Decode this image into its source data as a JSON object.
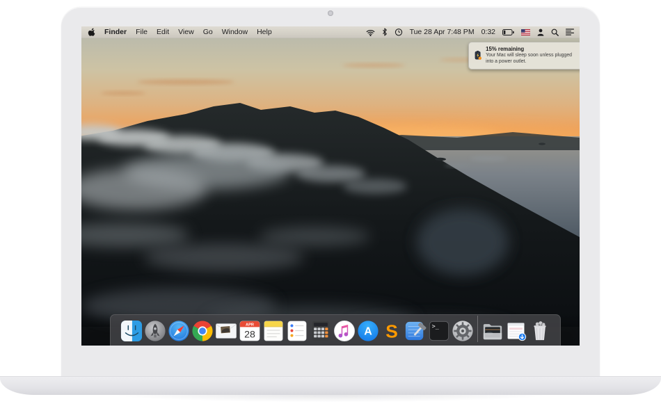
{
  "menu_bar": {
    "menus": [
      "Finder",
      "File",
      "Edit",
      "View",
      "Go",
      "Window",
      "Help"
    ],
    "status": {
      "datetime": "Tue 28 Apr  7:48 PM",
      "battery_time": "0:32",
      "icons": [
        "wifi-icon",
        "bluetooth-icon",
        "time-machine-icon",
        "battery-icon",
        "input-source-us-flag-icon",
        "fast-user-switching-icon",
        "spotlight-search-icon",
        "notification-center-icon"
      ]
    }
  },
  "notification": {
    "icon": "battery-low-icon",
    "title": "15% remaining",
    "body": "Your Mac will sleep soon unless plugged into a power outlet."
  },
  "dock": {
    "apps": [
      "finder",
      "launchpad",
      "safari",
      "chrome",
      "mail",
      "calendar",
      "notes",
      "reminders",
      "calculator",
      "itunes",
      "app-store",
      "sublime-text",
      "xcode",
      "terminal",
      "system-preferences",
      "documents-stack",
      "downloads-stack",
      "trash"
    ],
    "calendar_month": "APR",
    "calendar_day": "28",
    "terminal_glyph": ">_",
    "sublime_glyph": "S",
    "appstore_glyph": "A"
  },
  "colors": {
    "menubar_tint": "#d9d5cc",
    "dock_tint": "rgba(68,68,71,0.84)",
    "notification_bg": "#e6e3da",
    "battery_badge": "#f2921d",
    "sunset_accent": "#f09e50"
  }
}
